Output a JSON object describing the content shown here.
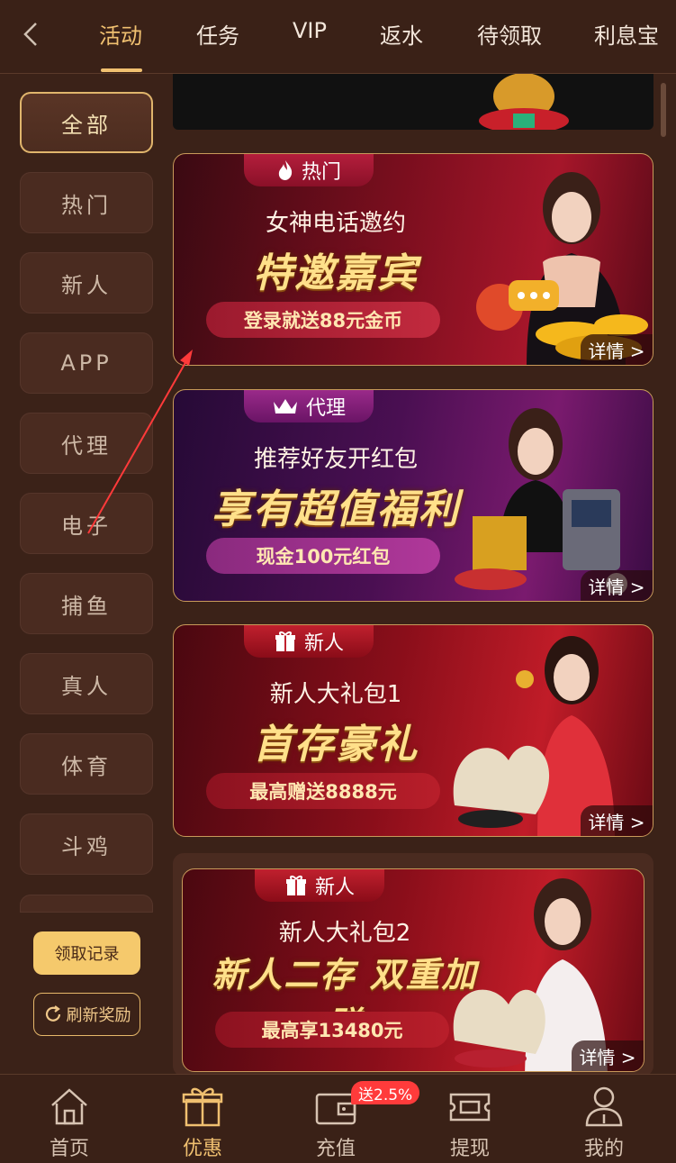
{
  "tabs": [
    "活动",
    "任务",
    "VIP",
    "返水",
    "待领取",
    "利息宝"
  ],
  "active_tab": "活动",
  "categories": [
    "全部",
    "热门",
    "新人",
    "APP",
    "代理",
    "电子",
    "捕鱼",
    "真人",
    "体育",
    "斗鸡"
  ],
  "active_category": "全部",
  "sidebar_buttons": {
    "claim": "领取记录",
    "refresh": "刷新奖励"
  },
  "banners": [
    {
      "tag": "热门",
      "line1": "女神电话邀约",
      "line2": "特邀嘉宾",
      "pill": "登录就送88元金币",
      "detail": "详情 >"
    },
    {
      "tag": "代理",
      "line1": "推荐好友开红包",
      "line2": "享有超值福利",
      "pill": "现金100元红包",
      "detail": "详情 >"
    },
    {
      "tag": "新人",
      "line1": "新人大礼包1",
      "line2": "首存豪礼",
      "pill": "最高赠送8888元",
      "detail": "详情 >"
    },
    {
      "tag": "新人",
      "line1": "新人大礼包2",
      "line2": "新人二存 双重加赠",
      "pill": "最高享13480元",
      "detail": "详情 >"
    }
  ],
  "bottom_nav": [
    "首页",
    "优惠",
    "充值",
    "提现",
    "我的"
  ],
  "active_nav": "优惠",
  "recharge_badge": "送2.5%",
  "colors": {
    "accent": "#f0c070",
    "background": "#3b2218",
    "badge": "#ff3b3b"
  }
}
